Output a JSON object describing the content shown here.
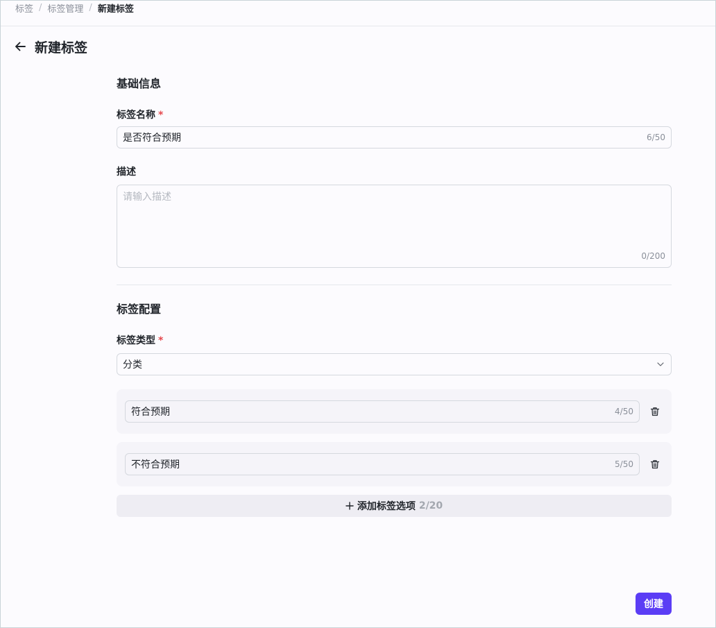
{
  "breadcrumb": {
    "items": [
      "标签",
      "标签管理",
      "新建标签"
    ],
    "separator": "/"
  },
  "page": {
    "title": "新建标签",
    "back_icon": "arrow-left-icon"
  },
  "basic_info": {
    "section_title": "基础信息",
    "name_label": "标签名称",
    "required_mark": "*",
    "name_value": "是否符合预期",
    "name_counter": "6/50",
    "description_label": "描述",
    "description_placeholder": "请输入描述",
    "description_counter": "0/200"
  },
  "config": {
    "section_title": "标签配置",
    "type_label": "标签类型",
    "required_mark": "*",
    "type_value": "分类",
    "options": [
      {
        "value": "符合预期",
        "counter": "4/50"
      },
      {
        "value": "不符合预期",
        "counter": "5/50"
      }
    ],
    "add_option_label": "添加标签选项",
    "add_option_count": "2/20"
  },
  "footer": {
    "create_label": "创建"
  },
  "colors": {
    "primary": "#5b3df5",
    "required": "#e5484d"
  }
}
